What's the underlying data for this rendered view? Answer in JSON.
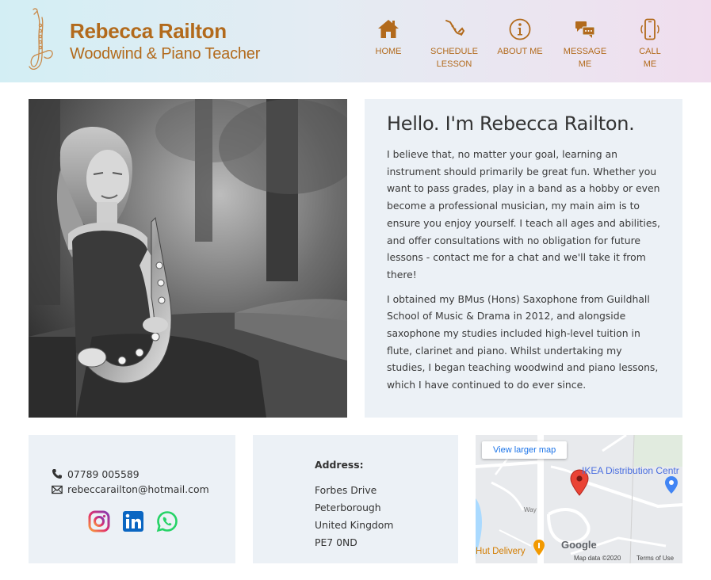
{
  "brand": {
    "name": "Rebecca Railton",
    "tagline": "Woodwind & Piano Teacher"
  },
  "nav": [
    {
      "label_1": "HOME",
      "label_2": "",
      "icon": "home-icon"
    },
    {
      "label_1": "SCHEDULE",
      "label_2": "LESSON",
      "icon": "saxophone-icon"
    },
    {
      "label_1": "ABOUT ME",
      "label_2": "",
      "icon": "info-icon"
    },
    {
      "label_1": "MESSAGE ME",
      "label_2": "",
      "icon": "chat-icon"
    },
    {
      "label_1": "CALL ME",
      "label_2": "",
      "icon": "phone-icon"
    }
  ],
  "bio": {
    "heading": "Hello. I'm Rebecca Railton.",
    "paragraph_1": "I believe that, no matter your goal, learning an instrument should primarily be great fun. Whether you want to pass grades, play in a band as a hobby or even become a professional musician, my main aim is to ensure you enjoy yourself. I teach all ages and abilities, and offer consultations with no obligation for future lessons - contact me for a chat and we'll take it from there!",
    "paragraph_2": "I obtained my BMus (Hons) Saxophone from Guildhall School of Music & Drama in 2012, and alongside saxophone my studies included high-level tuition in flute, clarinet and piano. Whilst undertaking my studies, I began teaching woodwind and piano lessons, which I have continued to do ever since."
  },
  "contact": {
    "phone": "07789 005589",
    "email": "rebeccarailton@hotmail.com",
    "socials": [
      "instagram-icon",
      "linkedin-icon",
      "whatsapp-icon"
    ]
  },
  "address": {
    "title": "Address:",
    "lines": [
      "Forbes Drive",
      "Peterborough",
      "United Kingdom",
      "PE7 0ND"
    ]
  },
  "map": {
    "button": "View larger map",
    "place_label": "IKEA Distribution Centr",
    "poi_label": "Hut Delivery",
    "road_label": "Way",
    "google": "Google",
    "attribution": "Map data ©2020",
    "terms": "Terms of Use"
  },
  "colors": {
    "accent": "#b26a1c",
    "card_bg": "#ecf1f6",
    "map_pin": "#ea4335",
    "link": "#1a73e8"
  }
}
